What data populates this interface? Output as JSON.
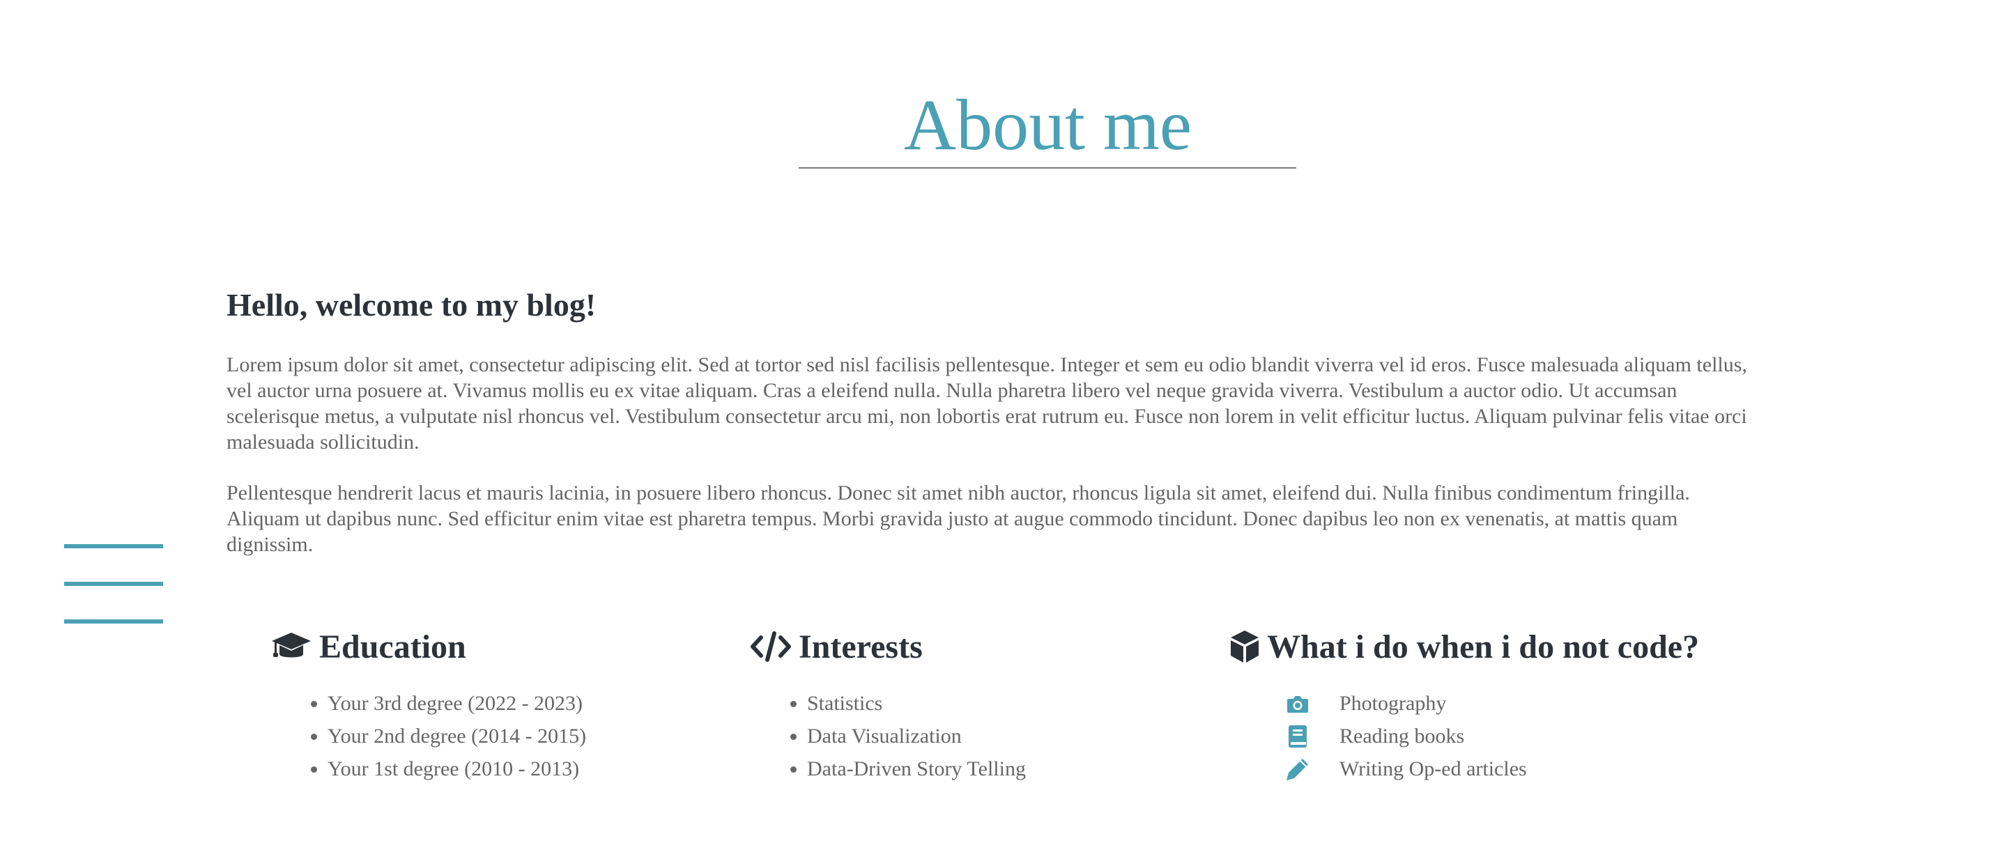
{
  "header": {
    "title": "About me"
  },
  "intro": {
    "heading": "Hello, welcome to my blog!",
    "paragraphs": [
      "Lorem ipsum dolor sit amet, consectetur adipiscing elit. Sed at tortor sed nisl facilisis pellentesque. Integer et sem eu odio blandit viverra vel id eros. Fusce malesuada aliquam tellus, vel auctor urna posuere at. Vivamus mollis eu ex vitae aliquam. Cras a eleifend nulla. Nulla pharetra libero vel neque gravida viverra. Vestibulum a auctor odio. Ut accumsan scelerisque metus, a vulputate nisl rhoncus vel. Vestibulum consectetur arcu mi, non lobortis erat rutrum eu. Fusce non lorem in velit efficitur luctus. Aliquam pulvinar felis vitae orci malesuada sollicitudin.",
      "Pellentesque hendrerit lacus et mauris lacinia, in posuere libero rhoncus. Donec sit amet nibh auctor, rhoncus ligula sit amet, eleifend dui. Nulla finibus condimentum fringilla. Aliquam ut dapibus nunc. Sed efficitur enim vitae est pharetra tempus. Morbi gravida justo at augue commodo tincidunt. Donec dapibus leo non ex venenatis, at mattis quam dignissim."
    ]
  },
  "education": {
    "icon": "graduation-cap-icon",
    "title": "Education",
    "items": [
      "Your 3rd degree (2022 - 2023)",
      "Your 2nd degree (2014 - 2015)",
      "Your 1st degree (2010 - 2013)"
    ]
  },
  "interests": {
    "icon": "code-icon",
    "title": "Interests",
    "items": [
      "Statistics",
      "Data Visualization",
      "Data-Driven Story Telling"
    ]
  },
  "hobbies": {
    "icon": "cube-icon",
    "title": "What i do when i do not code?",
    "items": [
      {
        "icon": "camera-icon",
        "label": "Photography"
      },
      {
        "icon": "book-icon",
        "label": "Reading books"
      },
      {
        "icon": "pencil-icon",
        "label": "Writing Op-ed articles"
      }
    ]
  },
  "menu": {
    "icon": "hamburger-menu-icon"
  },
  "colors": {
    "accent": "#4aa0b5",
    "heading": "#2d3239",
    "body_text": "#646464",
    "divider": "#7c7c7c"
  }
}
